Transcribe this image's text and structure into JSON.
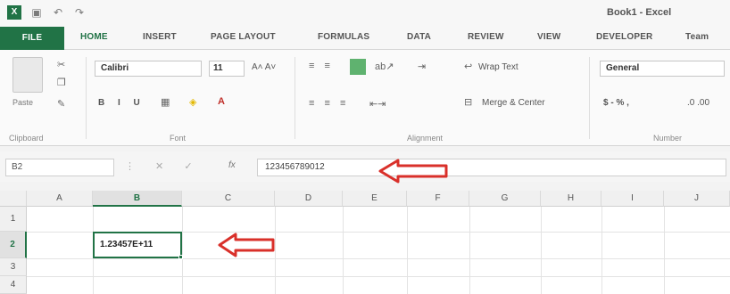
{
  "window": {
    "title": "Book1 - Excel"
  },
  "quick_access": {
    "app_icon": "excel-logo",
    "save_icon": "save-icon",
    "undo_icon": "undo-icon",
    "redo_icon": "redo-icon"
  },
  "tabs": [
    {
      "label": "FILE"
    },
    {
      "label": "HOME"
    },
    {
      "label": "INSERT"
    },
    {
      "label": "PAGE LAYOUT"
    },
    {
      "label": "FORMULAS"
    },
    {
      "label": "DATA"
    },
    {
      "label": "REVIEW"
    },
    {
      "label": "VIEW"
    },
    {
      "label": "DEVELOPER"
    },
    {
      "label": "Team"
    }
  ],
  "ribbon": {
    "paste_label": "Paste",
    "font_name": "Calibri",
    "font_size": "11",
    "wrap_text": "Wrap Text",
    "merge_center": "Merge & Center",
    "number_format": "General",
    "number_symbols": "$ - % ,",
    "groups": {
      "clipboard": "Clipboard",
      "font": "Font",
      "alignment": "Alignment",
      "number": "Number"
    }
  },
  "formula_bar": {
    "name_box": "B2",
    "fx_label": "fx",
    "value": "123456789012"
  },
  "grid": {
    "columns": [
      "A",
      "B",
      "C",
      "D",
      "E",
      "F",
      "G",
      "H",
      "I",
      "J"
    ],
    "rows": [
      "1",
      "2",
      "3",
      "4"
    ],
    "selected_cell_value": "1.23457E+11"
  },
  "colors": {
    "accent": "#217346",
    "arrow": "#d9302a"
  }
}
